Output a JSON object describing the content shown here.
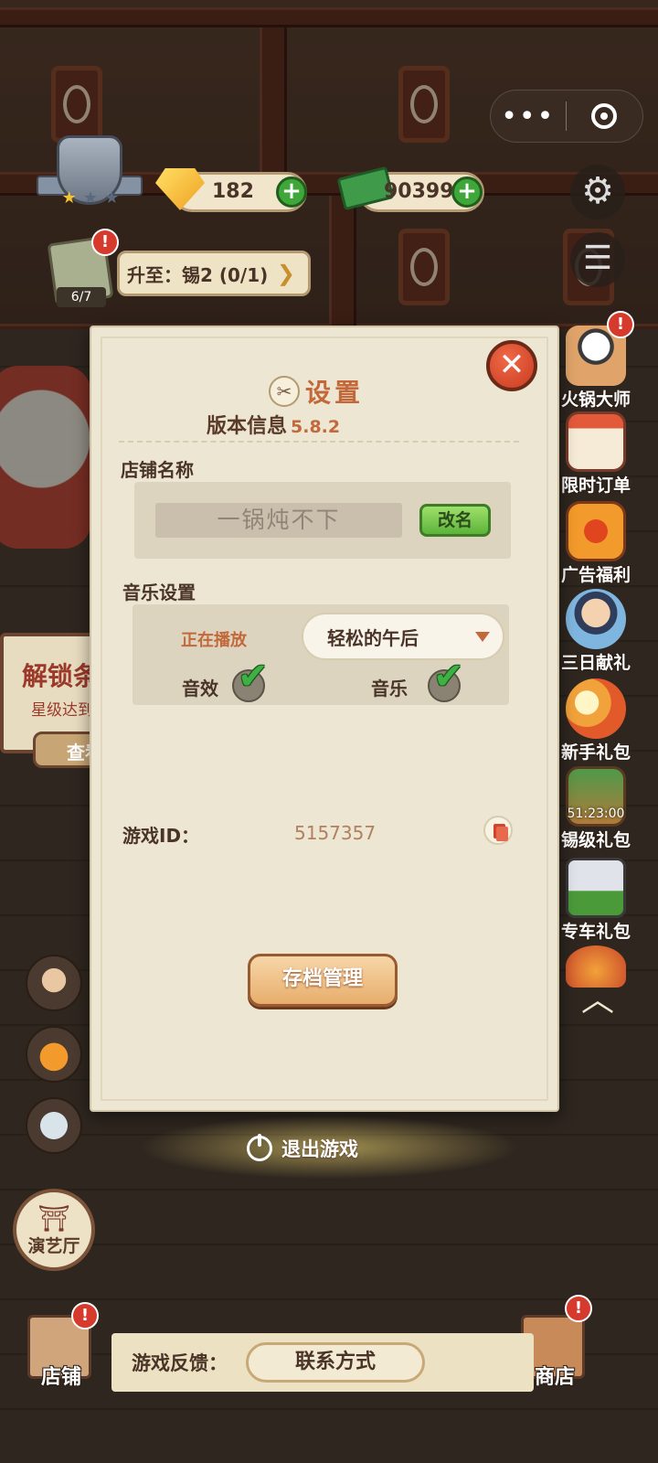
{
  "miniprogram": {
    "menu_icon": "more-dots-icon",
    "close_icon": "target-close-icon"
  },
  "hud": {
    "rank_stars": 1,
    "gems": "182",
    "cash": "90399",
    "quest_progress": "6/7",
    "upgrade_text": "升至：锡2 (0/1)"
  },
  "side_menu": [
    {
      "label": "火锅大师",
      "icon": "chef-panda-icon",
      "alert": true
    },
    {
      "label": "限时订单",
      "icon": "calendar-order-icon"
    },
    {
      "label": "广告福利",
      "icon": "tv-play-icon"
    },
    {
      "label": "三日献礼",
      "icon": "character-gift-icon"
    },
    {
      "label": "新手礼包",
      "icon": "food-bundle-icon"
    },
    {
      "label": "锡级礼包",
      "icon": "cash-chest-icon",
      "timer": "51:23:00"
    },
    {
      "label": "专车礼包",
      "icon": "car-gift-icon"
    }
  ],
  "left_board": {
    "unlock_title": "解锁条",
    "unlock_sub": "星级达到",
    "check_label": "查看"
  },
  "stage_button": {
    "label": "演艺厅"
  },
  "dialog": {
    "title": "设置",
    "version_label": "版本信息",
    "version": "5.8.2",
    "shop_name_label": "店铺名称",
    "shop_name": "一锅炖不下",
    "rename_label": "改名",
    "music_settings_label": "音乐设置",
    "now_playing_label": "正在播放",
    "now_playing": "轻松的午后",
    "sfx_label": "音效",
    "sfx_on": true,
    "music_label": "音乐",
    "music_on": true,
    "game_id_label": "游戏ID：",
    "game_id": "5157357",
    "save_manage_label": "存档管理"
  },
  "exit_label": "退出游戏",
  "bottom": {
    "shop_label": "店铺",
    "store_label": "商店",
    "feedback_label": "游戏反馈：",
    "contact_label": "联系方式"
  },
  "colors": {
    "accent_orange": "#c2683a",
    "close_red": "#d94a2e",
    "check_green": "#3fb044",
    "panel_bg": "#ede6d2"
  }
}
